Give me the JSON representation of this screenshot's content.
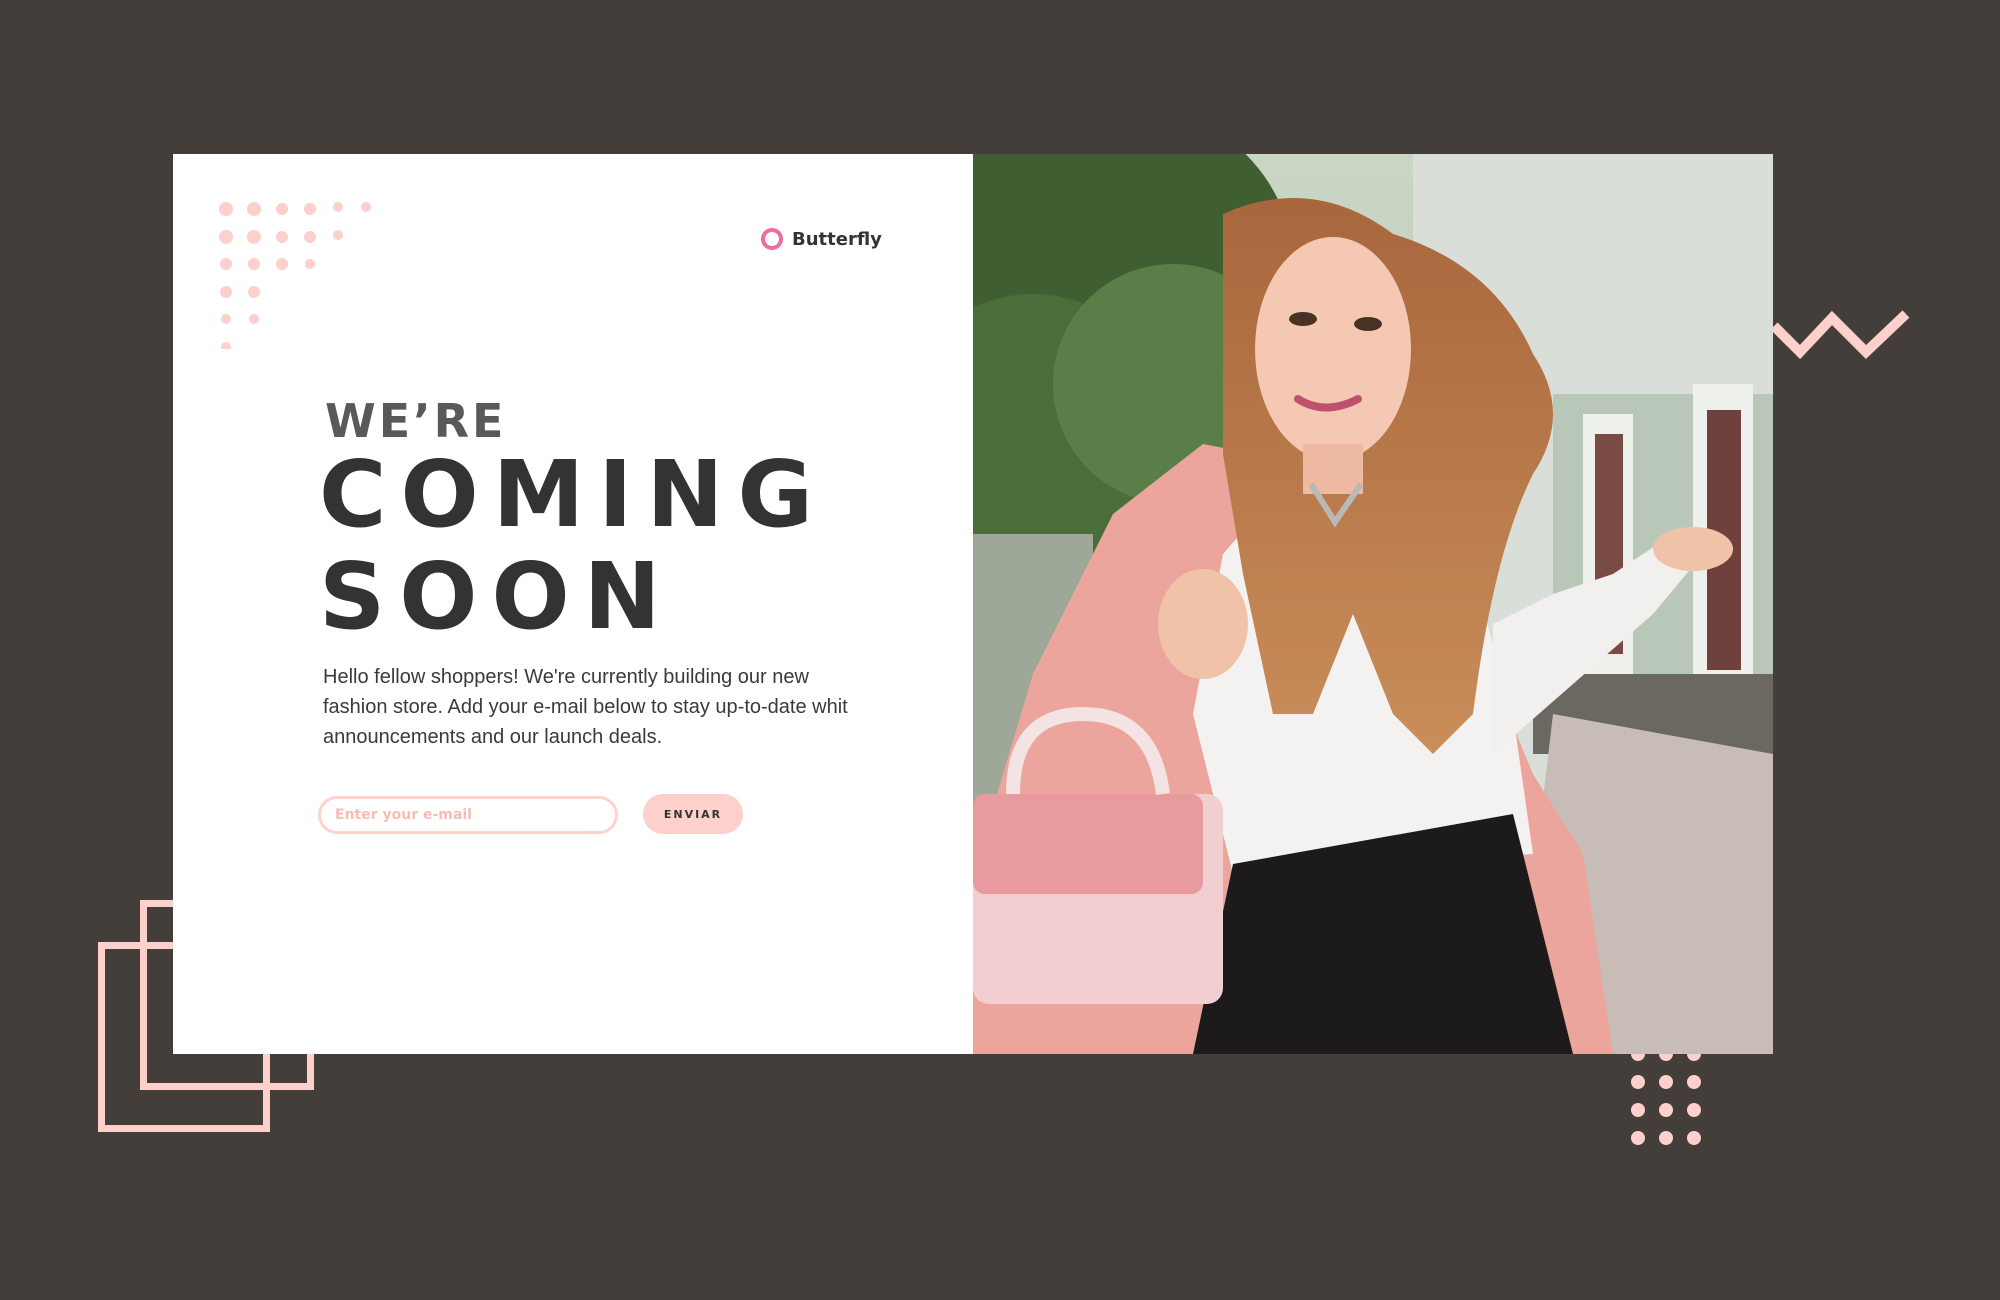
{
  "brand": {
    "name": "Butterfly",
    "icon": "ring-logo-icon",
    "accent": "#f06ba3"
  },
  "hero": {
    "line1": "WE’RE",
    "line2": "COMING",
    "line3": "SOON",
    "description": "Hello fellow shoppers! We're currently building our new fashion store. Add your e-mail below to stay up-to-date whit announcements and our launch deals."
  },
  "form": {
    "email_placeholder": "Enter your e-mail",
    "email_value": "",
    "submit_label": "ENVIAR"
  },
  "colors": {
    "background": "#443e3b",
    "pink": "#fdd0cb",
    "text": "#333333"
  }
}
